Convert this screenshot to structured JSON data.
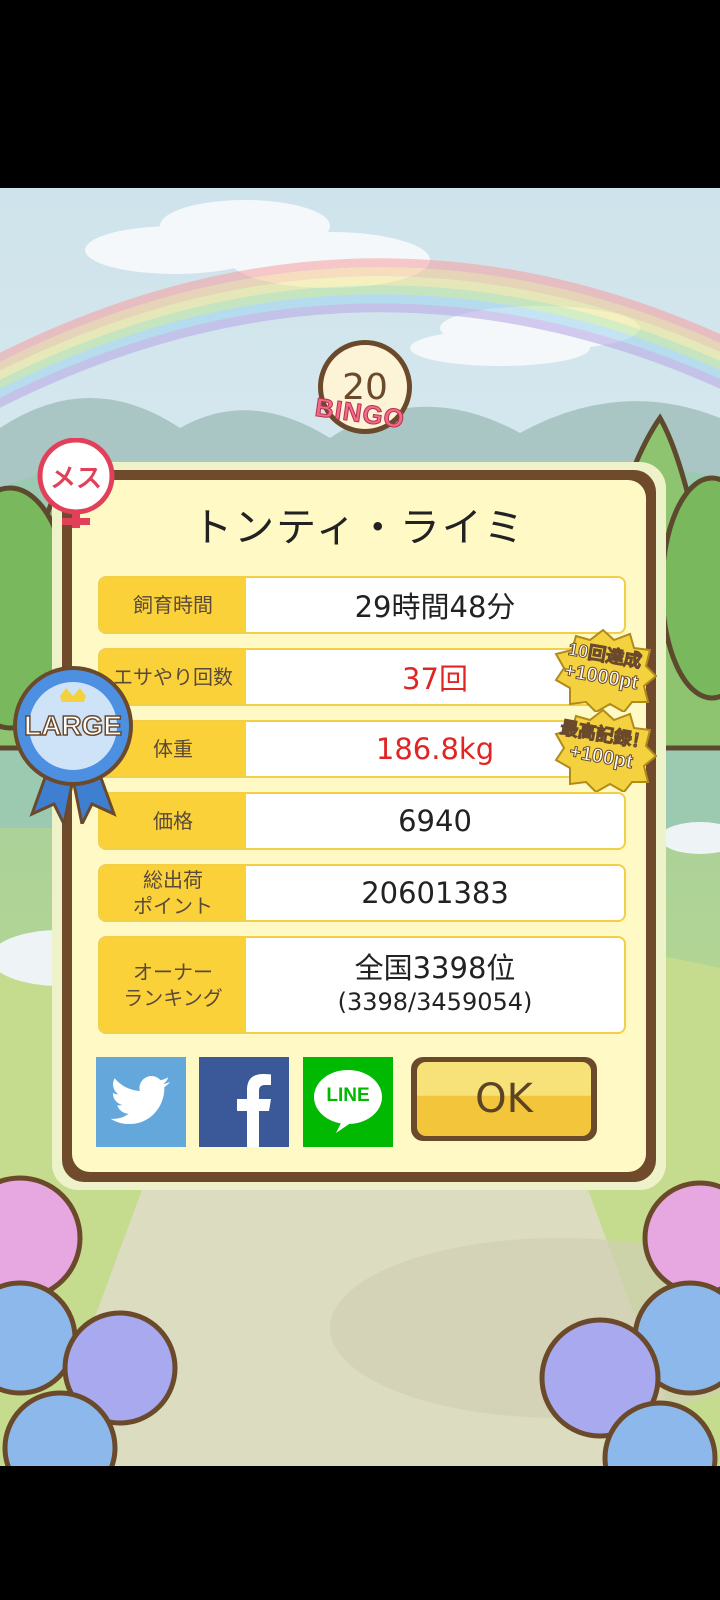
{
  "bingo": {
    "number": "20",
    "label": "BINGO"
  },
  "gender_badge": {
    "label": "メス"
  },
  "size_badge": {
    "label": "LARGE"
  },
  "pet_name": "トンティ・ライミ",
  "stats": [
    {
      "label": "飼育時間",
      "value": "29時間48分",
      "highlight": false
    },
    {
      "label": "エサやり回数",
      "value": "37回",
      "highlight": true
    },
    {
      "label": "体重",
      "value": "186.8kg",
      "highlight": true
    },
    {
      "label": "価格",
      "value": "6940",
      "highlight": false
    },
    {
      "label": "総出荷ポイント",
      "label_line1": "総出荷",
      "label_line2": "ポイント",
      "value": "20601383",
      "highlight": false
    }
  ],
  "ranking": {
    "label_line1": "オーナー",
    "label_line2": "ランキング",
    "value": "全国3398位",
    "detail": "(3398/3459054)"
  },
  "bonus_badges": [
    {
      "line1": "10回達成",
      "line2": "+1000pt"
    },
    {
      "line1": "最高記録！",
      "line2": "+100pt"
    }
  ],
  "share": {
    "twitter": "twitter-icon",
    "facebook": "facebook-icon",
    "line": "LINE"
  },
  "ok_button": "OK",
  "colors": {
    "label_bg": "#fbd13a",
    "card_border": "#6f4a2b",
    "highlight": "#e02525",
    "twitter": "#64a8db",
    "facebook": "#3b5998",
    "line": "#00b900"
  }
}
